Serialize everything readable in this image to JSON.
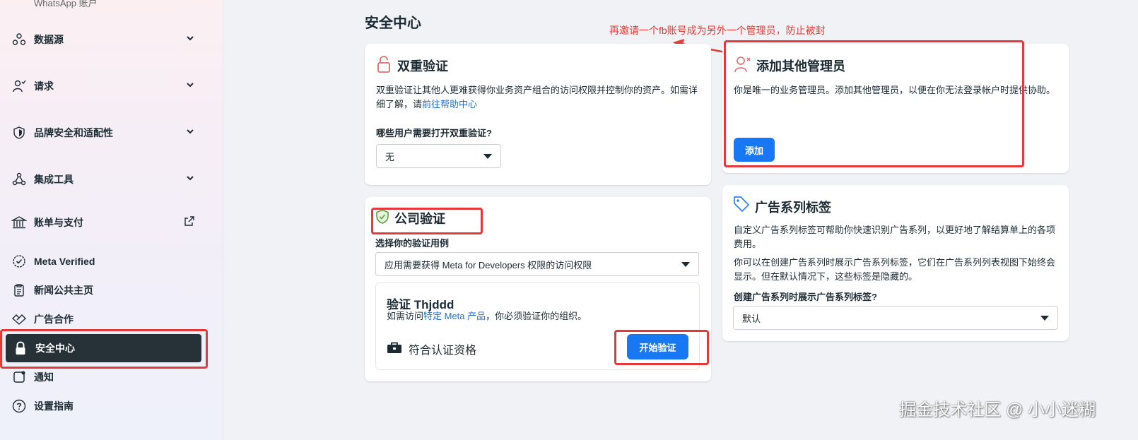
{
  "sidebar": {
    "top_cut": "WhatsApp 账户",
    "items": [
      {
        "label": "数据源"
      },
      {
        "label": "请求"
      },
      {
        "label": "品牌安全和适配性"
      },
      {
        "label": "集成工具"
      },
      {
        "label": "账单与支付"
      },
      {
        "label": "Meta Verified"
      },
      {
        "label": "新闻公共主页"
      },
      {
        "label": "广告合作"
      },
      {
        "label": "安全中心"
      },
      {
        "label": "通知"
      },
      {
        "label": "设置指南"
      }
    ]
  },
  "page": {
    "title": "安全中心",
    "annotation": "再邀请一个fb账号成为另外一个管理员，防止被封"
  },
  "two_factor": {
    "title": "双重验证",
    "desc": "双重验证让其他人更难获得你业务资产组合的访问权限并控制你的资产。如需详细了解，请",
    "link": "前往帮助中心",
    "question": "哪些用户需要打开双重验证?",
    "select_value": "无"
  },
  "admins": {
    "title": "添加其他管理员",
    "desc": "你是唯一的业务管理员。添加其他管理员，以便在你无法登录帐户时提供协助。",
    "button": "添加"
  },
  "company_verify": {
    "title": "公司验证",
    "use_case_label": "选择你的验证用例",
    "use_case_value": "应用需要获得 Meta for Developers 权限的访问权限",
    "verify_title": "验证 Thjddd",
    "verify_desc_pre": "如需访问",
    "verify_link": "特定 Meta 产品",
    "verify_desc_post": "，你必须验证你的组织。",
    "eligibility": "符合认证资格",
    "button": "开始验证"
  },
  "ad_tags": {
    "title": "广告系列标签",
    "desc1": "自定义广告系列标签可帮助你快速识别广告系列，以更好地了解结算单上的各项费用。",
    "desc2": "你可以在创建广告系列时展示广告系列标签，它们在广告系列列表视图下始终会显示。但在默认情况下，这些标签是隐藏的。",
    "question": "创建广告系列时展示广告系列标签?",
    "select_value": "默认"
  },
  "watermark": "掘金技术社区 @ 小小迷糊",
  "colors": {
    "accent": "#1877f2",
    "annotation_red": "#e53935",
    "active_nav_bg": "#263238"
  }
}
